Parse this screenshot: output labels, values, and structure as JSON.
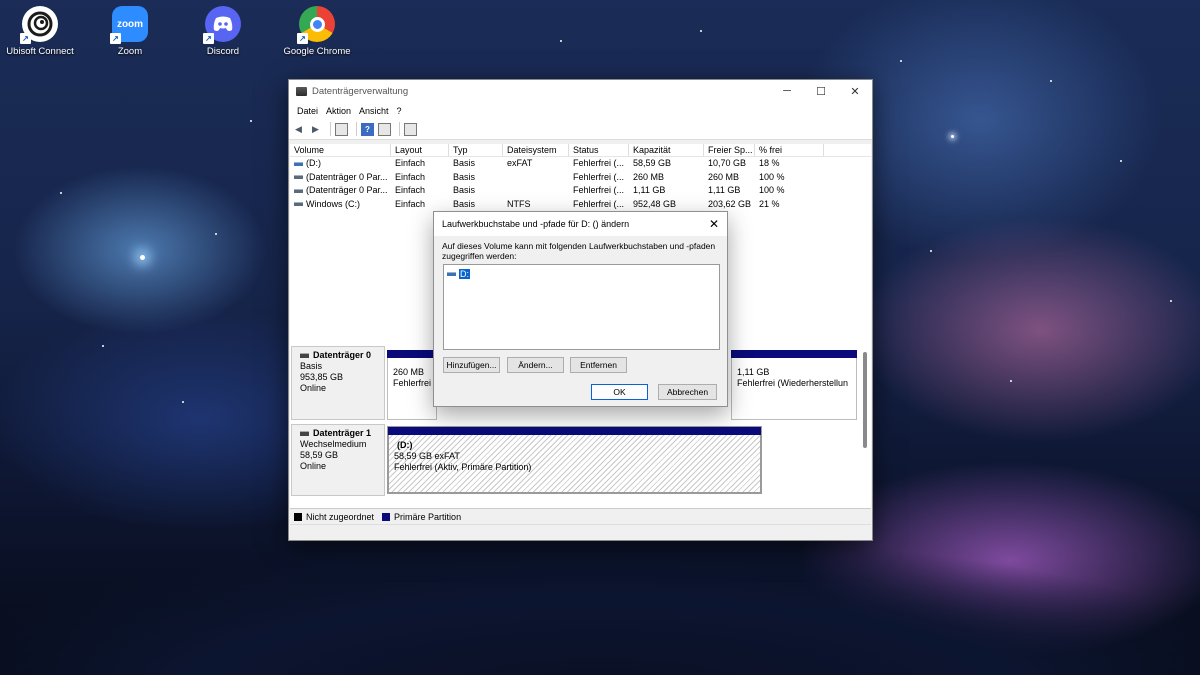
{
  "desktop": {
    "icons": [
      {
        "label": "Ubisoft Connect",
        "icon": "ubisoft-icon",
        "color": "#ffffff"
      },
      {
        "label": "Zoom",
        "icon": "zoom-icon",
        "color": "#2d8cff",
        "glyph": "zoom"
      },
      {
        "label": "Discord",
        "icon": "discord-icon",
        "color": "#5865f2"
      },
      {
        "label": "Google Chrome",
        "icon": "chrome-icon",
        "color": "#ffffff"
      }
    ],
    "shortcut_arrow": "↗"
  },
  "window": {
    "title": "Datenträgerverwaltung",
    "controls": {
      "minimize": "─",
      "maximize": "☐",
      "close": "✕"
    },
    "menu": [
      "Datei",
      "Aktion",
      "Ansicht",
      "?"
    ],
    "toolbar": {
      "back": "◀",
      "forward": "▶",
      "help": "?"
    }
  },
  "volumes": {
    "columns": [
      "Volume",
      "Layout",
      "Typ",
      "Dateisystem",
      "Status",
      "Kapazität",
      "Freier Sp...",
      "% frei"
    ],
    "rows": [
      [
        "(D:)",
        "Einfach",
        "Basis",
        "exFAT",
        "Fehlerfrei (...",
        "58,59 GB",
        "10,70 GB",
        "18 %"
      ],
      [
        "(Datenträger 0 Par...",
        "Einfach",
        "Basis",
        "",
        "Fehlerfrei (...",
        "260 MB",
        "260 MB",
        "100 %"
      ],
      [
        "(Datenträger 0 Par...",
        "Einfach",
        "Basis",
        "",
        "Fehlerfrei (...",
        "1,11 GB",
        "1,11 GB",
        "100 %"
      ],
      [
        "Windows (C:)",
        "Einfach",
        "Basis",
        "NTFS",
        "Fehlerfrei (...",
        "952,48 GB",
        "203,62 GB",
        "21 %"
      ]
    ]
  },
  "disks": {
    "disk0": {
      "name": "Datenträger 0",
      "type": "Basis",
      "size": "953,85 GB",
      "state": "Online",
      "part_left_size": "260 MB",
      "part_left_status": "Fehlerfrei",
      "part_right_size": "1,11 GB",
      "part_right_status": "Fehlerfrei (Wiederherstellun"
    },
    "disk1": {
      "name": "Datenträger 1",
      "type": "Wechselmedium",
      "size": "58,59 GB",
      "state": "Online",
      "part_name": "(D:)",
      "part_size": "58,59 GB exFAT",
      "part_status": "Fehlerfrei (Aktiv, Primäre Partition)"
    }
  },
  "legend": {
    "unallocated": "Nicht zugeordnet",
    "primary": "Primäre Partition",
    "unallocated_color": "#000000",
    "primary_color": "#0a0a7a"
  },
  "dialog": {
    "title": "Laufwerkbuchstabe und -pfade für D: () ändern",
    "close": "✕",
    "description": "Auf dieses Volume kann mit folgenden Laufwerkbuchstaben und -pfaden zugegriffen werden:",
    "entry": "D:",
    "buttons": {
      "add": "Hinzufügen...",
      "change": "Ändern...",
      "remove": "Entfernen",
      "ok": "OK",
      "cancel": "Abbrechen"
    }
  }
}
